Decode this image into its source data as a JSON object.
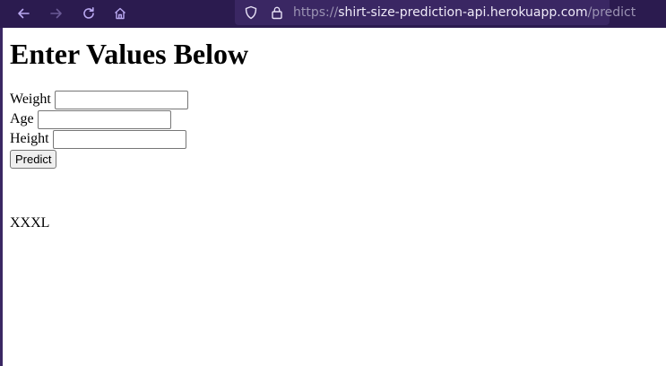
{
  "browser": {
    "url_scheme": "https://",
    "url_host": "shirt-size-prediction-api.herokuapp.com",
    "url_path": "/predict",
    "icons": [
      "back-icon",
      "forward-icon",
      "reload-icon",
      "home-icon",
      "tracking-protection-icon",
      "lock-icon"
    ],
    "toolbar_color": "#2b1b4f",
    "urlbar_color": "#3a2763"
  },
  "page": {
    "title": "Enter Values Below",
    "form": {
      "weight_label": "Weight",
      "weight_value": "",
      "age_label": "Age",
      "age_value": "",
      "height_label": "Height",
      "height_value": "",
      "submit_label": "Predict"
    },
    "prediction": "XXXL"
  }
}
